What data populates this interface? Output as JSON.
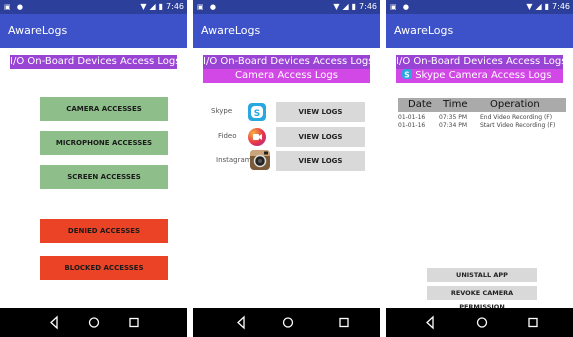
{
  "status": {
    "time": "7:46"
  },
  "app_title": "AwareLogs",
  "screen1": {
    "banner": "I/O On-Board Devices Access Logs",
    "buttons": [
      "CAMERA ACCESSES",
      "MICROPHONE ACCESSES",
      "SCREEN ACCESSES",
      "DENIED ACCESSES",
      "BLOCKED ACCESSES"
    ]
  },
  "screen2": {
    "banner": "I/O On-Board Devices Access Logs",
    "subbanner": "Camera Access Logs",
    "apps": [
      {
        "name": "Skype",
        "icon": "skype-icon",
        "button": "VIEW LOGS"
      },
      {
        "name": "Fideo",
        "icon": "fideo-icon",
        "button": "VIEW LOGS"
      },
      {
        "name": "Instagram",
        "icon": "instagram-icon",
        "button": "VIEW LOGS"
      }
    ]
  },
  "screen3": {
    "banner": "I/O On-Board Devices Access Logs",
    "subbanner": "Skype Camera Access Logs",
    "table": {
      "columns": [
        "Date",
        "Time",
        "Operation"
      ],
      "rows": [
        [
          "01-01-16",
          "07:35 PM",
          "End Video Recording (F)"
        ],
        [
          "01-01-16",
          "07:34 PM",
          "Start Video Recording (F)"
        ]
      ]
    },
    "uninstall_button": "UNISTALL APP",
    "revoke_button": "REVOKE CAMERA PERMISSION"
  },
  "colors": {
    "status_bar": "#2c3f9a",
    "app_bar": "#3d52c8",
    "banner_purple": "#9a44d6",
    "banner_magenta": "#d248e6",
    "green_button": "#8ebf8a",
    "red_button": "#ea4325",
    "gray_button": "#d9d9d9"
  }
}
